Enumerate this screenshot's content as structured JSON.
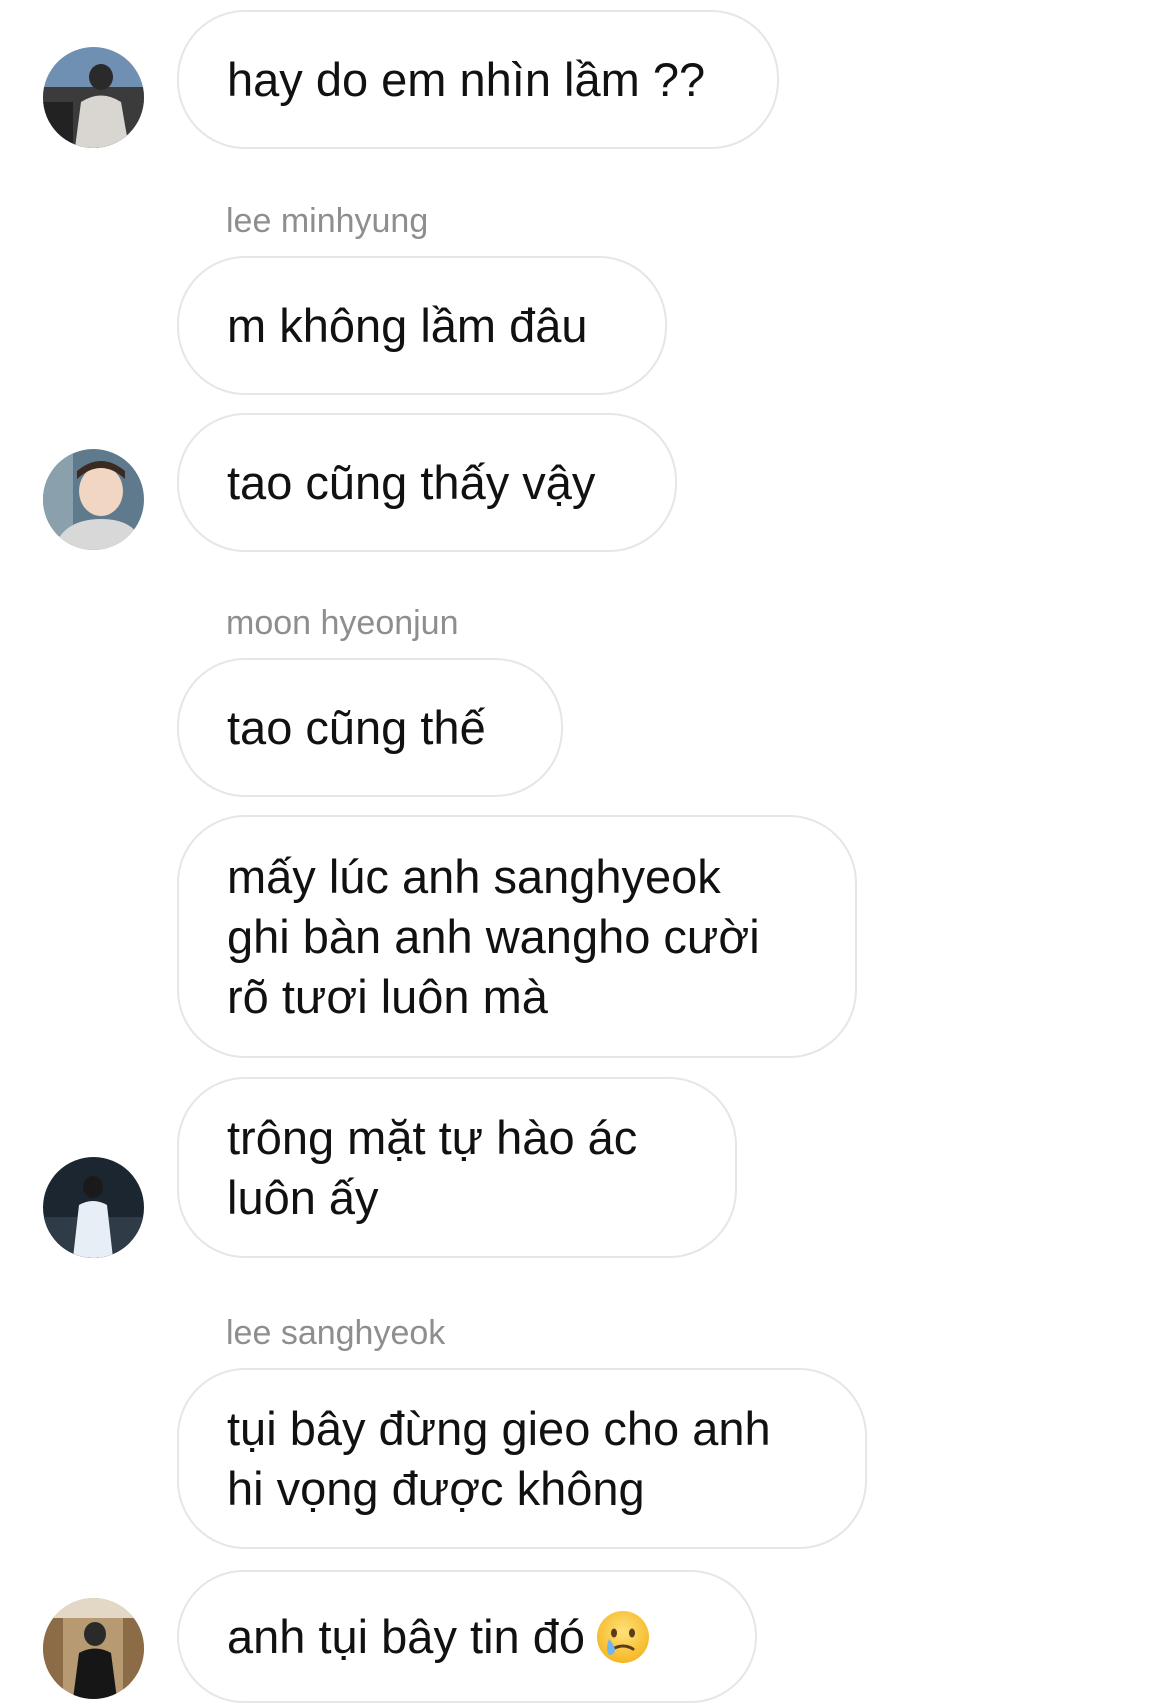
{
  "messages": [
    {
      "text": "hay do em nhìn lầm ??"
    },
    {
      "text": "m không lầm đâu"
    },
    {
      "text": "tao cũng thấy vậy"
    },
    {
      "text": "tao cũng thế"
    },
    {
      "text": "mấy lúc anh sanghyeok\nghi bàn anh wangho cười\nrõ tươi luôn mà"
    },
    {
      "text": "trông mặt tự hào ác\nluôn ấy"
    },
    {
      "text": "tụi bây đừng gieo cho anh\nhi vọng được không"
    },
    {
      "text": "anh tụi bây tin đó"
    }
  ],
  "senders": {
    "s1": "lee minhyung",
    "s2": "moon hyeonjun",
    "s3": "lee sanghyeok"
  },
  "icons": {
    "last_message_emoji": "sad-but-relieved-face-emoji"
  },
  "colors": {
    "bubble_border": "#e6e6e6",
    "sender_name": "#8e8e8e",
    "message_text": "#111111",
    "background": "#ffffff"
  }
}
